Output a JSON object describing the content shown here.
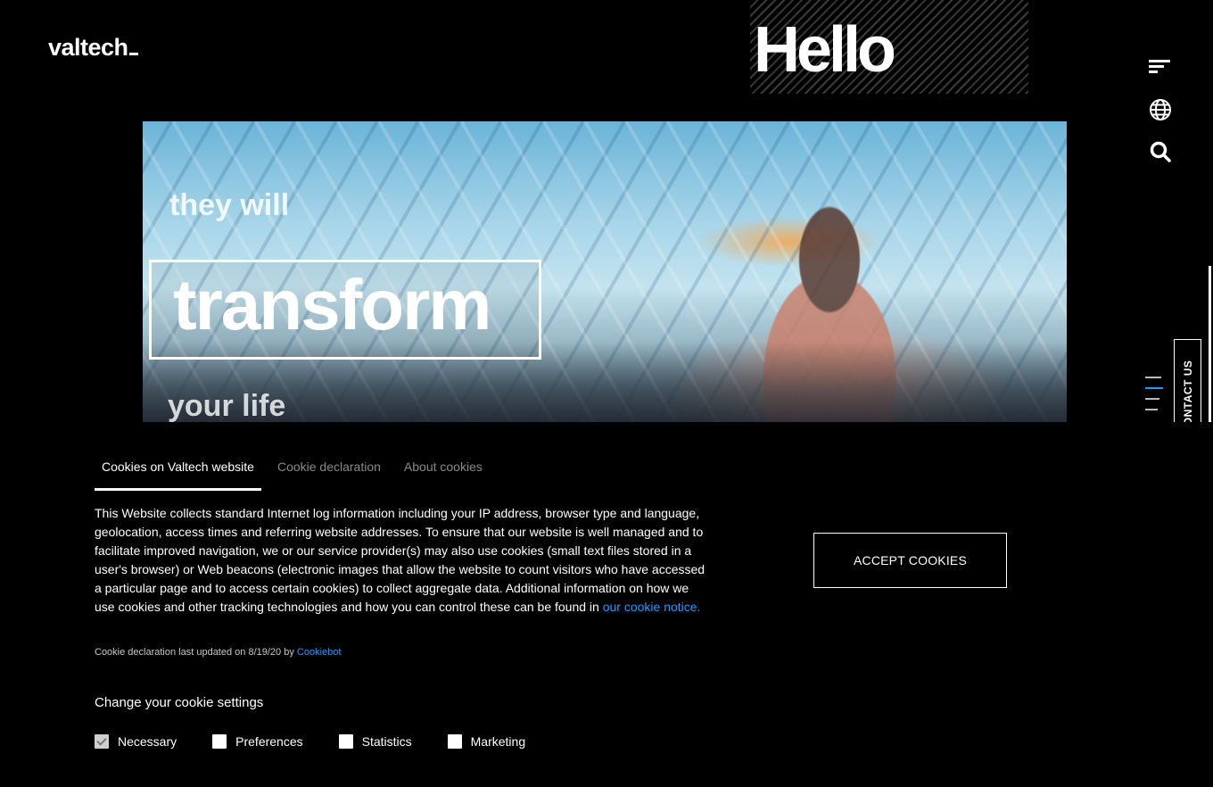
{
  "brand": {
    "logo_text": "valtech"
  },
  "header": {
    "hello_text": "Hello",
    "icons": [
      "menu-icon",
      "globe-icon",
      "search-icon"
    ]
  },
  "hero": {
    "caption_top": "they will",
    "headline": "transform",
    "caption_bottom": "your life"
  },
  "side": {
    "contact_label": "CONTACT US"
  },
  "cookie": {
    "tabs": [
      {
        "label": "Cookies on Valtech website",
        "active": true
      },
      {
        "label": "Cookie declaration",
        "active": false
      },
      {
        "label": "About cookies",
        "active": false
      }
    ],
    "body_text": "This Website collects standard Internet log information including your IP address, browser type and language, geolocation, access times and referring website addresses. To ensure that our website is well managed and to facilitate improved navigation, we or our service provider(s) may also use cookies (small text files stored in a user's browser) or Web beacons (electronic images that allow the website to count visitors who have accessed a particular page and to access certain cookies) to collect aggregate data. Additional information on how we use cookies and other tracking technologies and how you can control these can be found in ",
    "body_link": "our cookie notice.",
    "note_text": "Cookie declaration last updated on 8/19/20 by ",
    "note_link": "Cookiebot",
    "accept_label": "ACCEPT COOKIES",
    "settings_title": "Change your cookie settings",
    "options": [
      {
        "label": "Necessary",
        "checked": true,
        "disabled": true
      },
      {
        "label": "Preferences",
        "checked": false,
        "disabled": false
      },
      {
        "label": "Statistics",
        "checked": false,
        "disabled": false
      },
      {
        "label": "Marketing",
        "checked": false,
        "disabled": false
      }
    ]
  },
  "colors": {
    "background": "#000000",
    "link": "#1f9bff",
    "accent": "#1f9bff"
  }
}
